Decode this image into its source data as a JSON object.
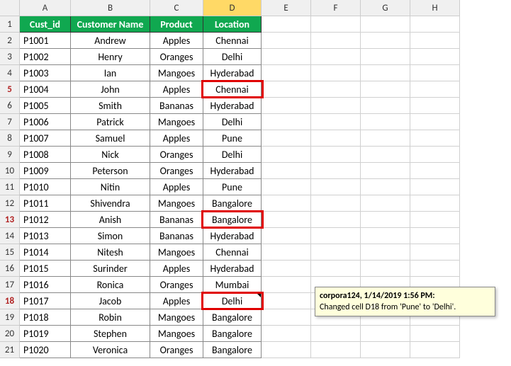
{
  "columns": [
    "A",
    "B",
    "C",
    "D",
    "E",
    "F",
    "G",
    "H"
  ],
  "headers": {
    "cust_id": "Cust_id",
    "customer_name": "Customer Name",
    "product": "Product",
    "location": "Location"
  },
  "rows": [
    {
      "n": "1"
    },
    {
      "n": "2",
      "id": "P1001",
      "name": "Andrew",
      "product": "Apples",
      "location": "Chennai"
    },
    {
      "n": "3",
      "id": "P1002",
      "name": "Henry",
      "product": "Oranges",
      "location": "Delhi"
    },
    {
      "n": "4",
      "id": "P1003",
      "name": "Ian",
      "product": "Mangoes",
      "location": "Hyderabad"
    },
    {
      "n": "5",
      "id": "P1004",
      "name": "John",
      "product": "Apples",
      "location": "Chennai",
      "hl": true
    },
    {
      "n": "6",
      "id": "P1005",
      "name": "Smith",
      "product": "Bananas",
      "location": "Hyderabad"
    },
    {
      "n": "7",
      "id": "P1006",
      "name": "Patrick",
      "product": "Mangoes",
      "location": "Delhi"
    },
    {
      "n": "8",
      "id": "P1007",
      "name": "Samuel",
      "product": "Apples",
      "location": "Pune"
    },
    {
      "n": "9",
      "id": "P1008",
      "name": "Nick",
      "product": "Oranges",
      "location": "Delhi"
    },
    {
      "n": "10",
      "id": "P1009",
      "name": "Peterson",
      "product": "Oranges",
      "location": "Hyderabad"
    },
    {
      "n": "11",
      "id": "P1010",
      "name": "Nitin",
      "product": "Apples",
      "location": "Pune"
    },
    {
      "n": "12",
      "id": "P1011",
      "name": "Shivendra",
      "product": "Mangoes",
      "location": "Bangalore"
    },
    {
      "n": "13",
      "id": "P1012",
      "name": "Anish",
      "product": "Bananas",
      "location": "Bangalore",
      "hl": true
    },
    {
      "n": "14",
      "id": "P1013",
      "name": "Simon",
      "product": "Bananas",
      "location": "Hyderabad"
    },
    {
      "n": "15",
      "id": "P1014",
      "name": "Nitesh",
      "product": "Mangoes",
      "location": "Chennai"
    },
    {
      "n": "16",
      "id": "P1015",
      "name": "Surinder",
      "product": "Apples",
      "location": "Hyderabad"
    },
    {
      "n": "17",
      "id": "P1016",
      "name": "Ronica",
      "product": "Oranges",
      "location": "Mumbai"
    },
    {
      "n": "18",
      "id": "P1017",
      "name": "Jacob",
      "product": "Apples",
      "location": "Delhi",
      "hl": true
    },
    {
      "n": "19",
      "id": "P1018",
      "name": "Robin",
      "product": "Mangoes",
      "location": "Bangalore"
    },
    {
      "n": "20",
      "id": "P1019",
      "name": "Stephen",
      "product": "Mangoes",
      "location": "Bangalore"
    },
    {
      "n": "21",
      "id": "P1020",
      "name": "Veronica",
      "product": "Oranges",
      "location": "Bangalore"
    }
  ],
  "comment": {
    "author_time": "corpora124, 1/14/2019 1:56 PM:",
    "text": "Changed cell D18 from 'Pune' to 'Delhi'."
  },
  "selected_column": "D"
}
